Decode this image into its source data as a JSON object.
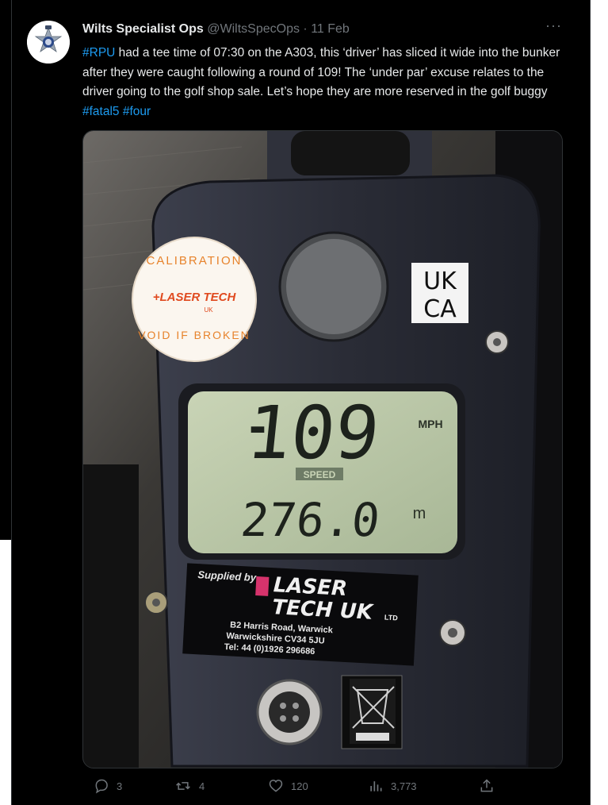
{
  "tweet": {
    "display_name": "Wilts Specialist Ops",
    "handle": "@WiltsSpecOps",
    "separator": "·",
    "date": "11 Feb",
    "more_label": "···",
    "text_parts": {
      "hashtag_rpu": "#RPU",
      "body": " had a tee time of 07:30 on the A303, this ‘driver’ has sliced it wide into the bunker after they were caught following a round of 109! The ‘under par’ excuse relates to the driver going to the golf shop sale. Let’s hope they are more reserved in the golf buggy ",
      "hashtag_fatal5": "#fatal5",
      "space": " ",
      "hashtag_four": "#four"
    }
  },
  "photo": {
    "sticker_top": "CALIBRATION",
    "sticker_brand": "+LASER TECH",
    "sticker_sub": "UK",
    "sticker_bottom": "VOID IF BROKEN",
    "ukca_line1": "UK",
    "ukca_line2": "CA",
    "speed_sign": "-",
    "speed_value": "109",
    "speed_unit": "MPH",
    "speed_label": "SPEED",
    "distance_value": "276.0",
    "distance_unit": "m",
    "supplied_by": "Supplied by",
    "brand_line1": "LASER",
    "brand_line2": "TECH UK",
    "brand_suffix": "LTD",
    "address_1": "B2 Harris Road, Warwick",
    "address_2": "Warwickshire CV34 5JU",
    "address_3": "Tel: 44 (0)1926 296686"
  },
  "actions": {
    "replies": "3",
    "retweets": "4",
    "likes": "120",
    "views": "3,773"
  },
  "colors": {
    "background": "#000000",
    "text": "#e7e9ea",
    "muted": "#71767b",
    "link": "#1d9bf0",
    "lcd": "#b8c6a4"
  }
}
